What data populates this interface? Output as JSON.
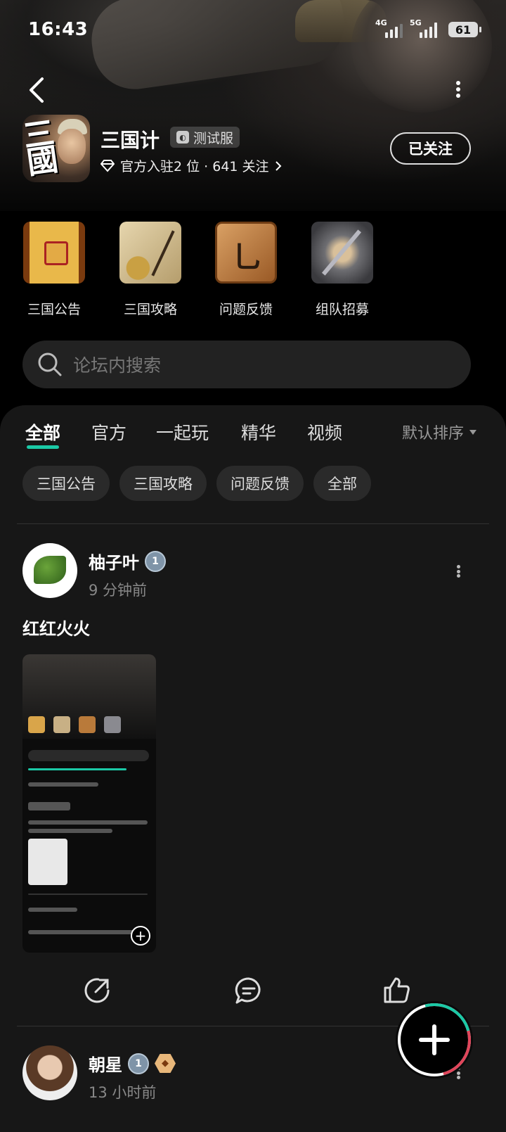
{
  "status_bar": {
    "time": "16:43",
    "net1": "4G",
    "net2": "5G",
    "battery": "61"
  },
  "header": {
    "game_title": "三国计",
    "badge": "测试服",
    "official_text": "官方入驻2 位 · 641 关注",
    "follow_label": "已关注"
  },
  "shortcuts": [
    {
      "label": "三国公告",
      "icon": "scroll-icon"
    },
    {
      "label": "三国攻略",
      "icon": "map-icon"
    },
    {
      "label": "问题反馈",
      "icon": "brush-board-icon"
    },
    {
      "label": "组队招募",
      "icon": "weapons-icon"
    }
  ],
  "search": {
    "placeholder": "论坛内搜索"
  },
  "tabs": [
    {
      "label": "全部",
      "active": true
    },
    {
      "label": "官方"
    },
    {
      "label": "一起玩"
    },
    {
      "label": "精华"
    },
    {
      "label": "视频"
    }
  ],
  "sort_label": "默认排序",
  "chips": [
    "三国公告",
    "三国攻略",
    "问题反馈",
    "全部"
  ],
  "posts": [
    {
      "user": "柚子叶",
      "level": "1",
      "time": "9 分钟前",
      "title": "红红火火"
    },
    {
      "user": "朝星",
      "level": "1",
      "time": "13 小时前"
    }
  ],
  "colors": {
    "accent": "#1bc9a6",
    "panel_bg": "#171717",
    "chip_bg": "#2a2a2a"
  }
}
